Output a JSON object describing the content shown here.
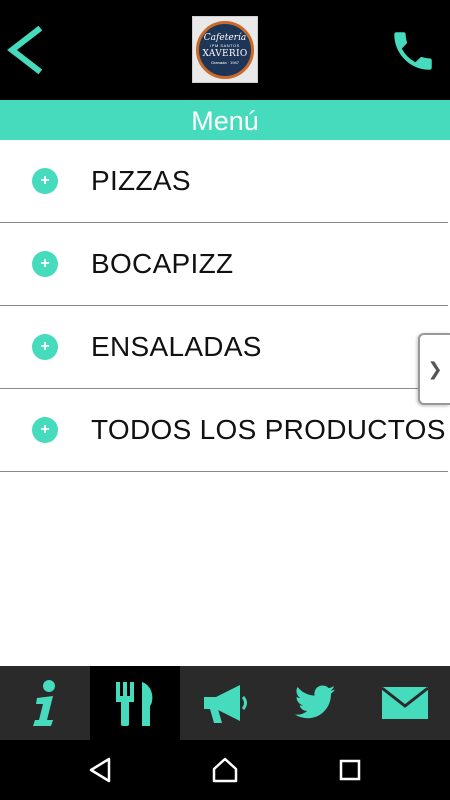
{
  "header": {
    "back_icon": "chevron-left-icon",
    "phone_icon": "phone-icon",
    "logo": {
      "line1": "Cafetería",
      "line2": "IPM SANTOS",
      "line3": "XAVERIO",
      "line4": "Granada · 1947"
    },
    "accent_color": "#47dbbd"
  },
  "title": "Menú",
  "menu": {
    "items": [
      {
        "label": "PIZZAS",
        "icon": "plus-icon"
      },
      {
        "label": "BOCAPIZZ",
        "icon": "plus-icon"
      },
      {
        "label": "ENSALADAS",
        "icon": "plus-icon"
      },
      {
        "label": "TODOS LOS PRODUCTOS",
        "icon": "plus-icon"
      }
    ]
  },
  "side_tab": {
    "glyph": "❯"
  },
  "tabbar": {
    "tabs": [
      {
        "name": "info",
        "icon": "info-icon",
        "active": false
      },
      {
        "name": "menu",
        "icon": "fork-knife-icon",
        "active": true
      },
      {
        "name": "announcements",
        "icon": "megaphone-icon",
        "active": false
      },
      {
        "name": "twitter",
        "icon": "twitter-icon",
        "active": false
      },
      {
        "name": "email",
        "icon": "mail-icon",
        "active": false
      }
    ]
  },
  "system_nav": {
    "back": "back-triangle-icon",
    "home": "home-icon",
    "recents": "recents-icon"
  }
}
